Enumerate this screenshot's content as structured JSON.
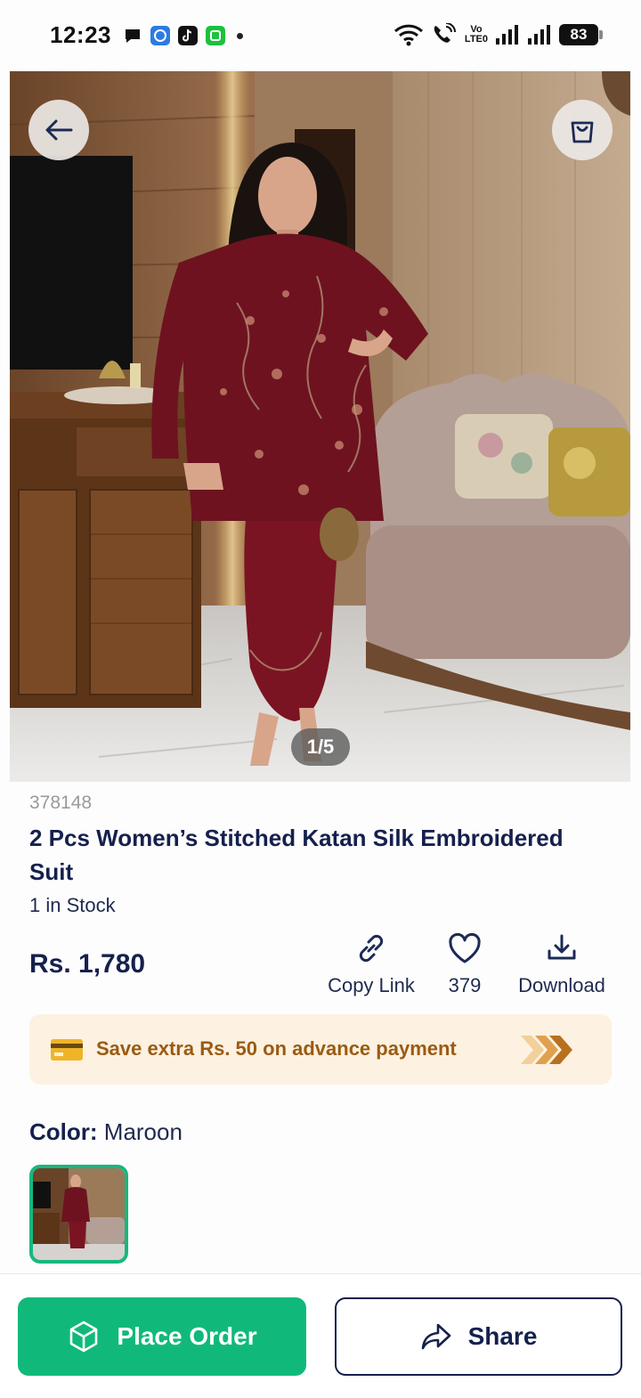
{
  "status_bar": {
    "time": "12:23",
    "volte_top": "Vo",
    "volte_bottom": "LTE0",
    "battery": "83",
    "icons": [
      "chat-icon",
      "app-icon",
      "tiktok-icon",
      "wechat-icon",
      "wifi-icon",
      "call-icon",
      "signal-icon",
      "signal-icon"
    ]
  },
  "gallery": {
    "pager": "1/5",
    "back_icon": "arrow-left-icon",
    "cart_icon": "shopping-bag-icon"
  },
  "product": {
    "sku": "378148",
    "title": "2 Pcs Women’s Stitched Katan Silk Embroidered Suit",
    "stock": "1 in Stock",
    "price": "Rs. 1,780"
  },
  "actions": {
    "copy_link": "Copy Link",
    "likes": "379",
    "download": "Download"
  },
  "promo": {
    "text": "Save extra Rs. 50 on advance payment"
  },
  "color": {
    "label": "Color:",
    "value": "Maroon"
  },
  "bottom": {
    "order_label": "Place Order",
    "share_label": "Share"
  },
  "colors": {
    "accent_green": "#10b97a",
    "navy": "#15204d",
    "promo_bg": "#fdf1e1",
    "promo_text": "#9a5b13",
    "dress_maroon": "#6e1220"
  }
}
